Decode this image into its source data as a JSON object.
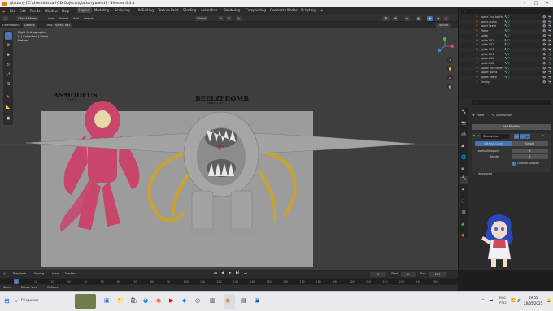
{
  "window": {
    "title": "glattony [C:\\Users\\lusuari\\3D Objects\\glattony.blend] - Blender 4.4.1",
    "min": "–",
    "max": "□",
    "close": "✕"
  },
  "menu": {
    "items": [
      "File",
      "Edit",
      "Render",
      "Window",
      "Help"
    ]
  },
  "workspaces": {
    "tabs": [
      "Layout",
      "Modeling",
      "Sculpting",
      "UV Editing",
      "Texture Paint",
      "Shading",
      "Animation",
      "Rendering",
      "Compositing",
      "Geometry Nodes",
      "Scripting"
    ],
    "add": "+"
  },
  "scene": {
    "label": "Scene",
    "viewlayer": "ViewLayer"
  },
  "header3d": {
    "mode": "Object Mode",
    "view": "View",
    "select": "Select",
    "add": "Add",
    "object": "Object",
    "orient": "Global",
    "options": "Options"
  },
  "tooloptions": {
    "orientation_label": "Orientation:",
    "orientation": "Default",
    "drag_label": "Drag:",
    "drag": "Select Box"
  },
  "viewport_info": {
    "line1": "Right Orthographic",
    "line2": "(1) Collection | Plane",
    "line3": "Meters"
  },
  "reference": {
    "left_title": "ASMODEUS",
    "left_sub": "(LUST)",
    "right_title": "BEELZEBOMB",
    "right_sub": "(GLUTTONY)"
  },
  "outliner": {
    "search_placeholder": "",
    "rows": [
      {
        "name": "lower 2nd teeth"
      },
      {
        "name": "lower gums"
      },
      {
        "name": "lower teeth"
      },
      {
        "name": "Plane"
      },
      {
        "name": "spike"
      },
      {
        "name": "spike.001"
      },
      {
        "name": "spike.002"
      },
      {
        "name": "spike.003"
      },
      {
        "name": "spike.004"
      },
      {
        "name": "spike.005"
      },
      {
        "name": "spike.006"
      },
      {
        "name": "upper 2nd teeth"
      },
      {
        "name": "upper gums"
      },
      {
        "name": "upper teeth"
      },
      {
        "name": "Empty"
      }
    ]
  },
  "properties": {
    "breadcrumb_obj": "Plane",
    "breadcrumb_mod": "Subdivision",
    "add_modifier": "Add Modifier",
    "modifier_name": "Subdivision",
    "catmull": "Catmull-Clark",
    "simple": "Simple",
    "levels_viewport_label": "Levels Viewport",
    "levels_viewport": "3",
    "render_label": "Render",
    "render": "2",
    "optimal": "Optimal Display",
    "advanced": "Advanced"
  },
  "timeline": {
    "playback": "Playback",
    "keying": "Keying",
    "view": "View",
    "marker": "Marker",
    "current_frame": "1",
    "start_label": "Start",
    "start": "1",
    "end_label": "End",
    "end": "250",
    "ticks": [
      "10",
      "20",
      "30",
      "40",
      "50",
      "60",
      "70",
      "80",
      "90",
      "100",
      "110",
      "120",
      "130",
      "140",
      "150",
      "160",
      "170",
      "180",
      "190",
      "200",
      "210",
      "220",
      "230",
      "240",
      "250"
    ]
  },
  "statusbar": {
    "select": "Select",
    "rotate": "Rotate View",
    "options": "Options",
    "version": "4.4.1"
  },
  "taskbar": {
    "search": "Pesquisar",
    "time": "19:55",
    "date": "28/05/2025",
    "lang": "ENG",
    "lang2": "PTB2"
  },
  "colors": {
    "accent": "#4772b3",
    "pink": "#c8456c",
    "gold": "#c8a22c",
    "grey_model": "#9a9a9a"
  }
}
